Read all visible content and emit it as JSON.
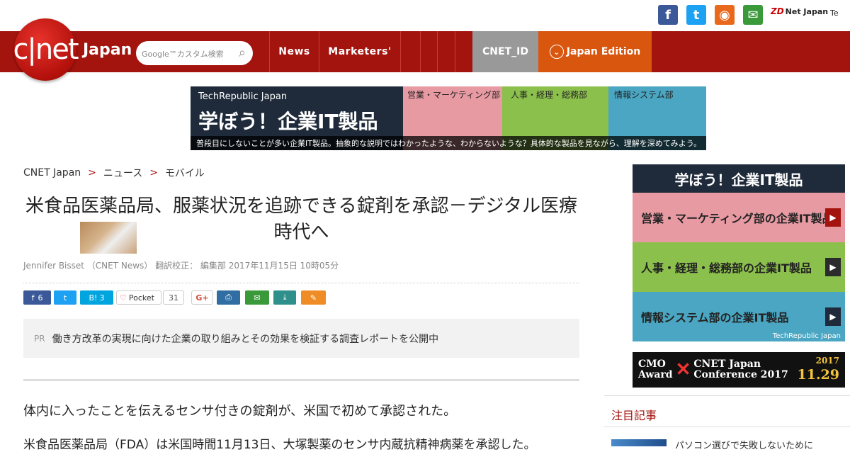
{
  "header": {
    "social": [
      {
        "name": "facebook-icon",
        "glyph": "f",
        "color": "#3b5998"
      },
      {
        "name": "twitter-icon",
        "glyph": "t",
        "color": "#1da1f2"
      },
      {
        "name": "rss-icon",
        "glyph": "◉",
        "color": "#e8691c"
      },
      {
        "name": "mail-icon",
        "glyph": "✉",
        "color": "#3a9a3a"
      }
    ],
    "zdnet_label": "Net Japan",
    "zdnet_mark": "ZD",
    "tech_label": "Te"
  },
  "nav": {
    "logo": "c|net",
    "brand": "Japan",
    "search_placeholder": "Google™カスタム検索",
    "items": [
      "News",
      "Marketers'"
    ],
    "cnet_id": "CNET_ID",
    "edition": "Japan Edition"
  },
  "banner": {
    "publisher": "TechRepublic Japan",
    "headline": "学ぼう！企業IT製品",
    "categories": [
      "営業・マーケティング部",
      "人事・経理・総務部",
      "情報システム部"
    ],
    "tagline": "普段目にしないことが多い企業IT製品。抽象的な説明ではわかったような、わからないような？具体的な製品を見ながら、理解を深めてみよう。"
  },
  "article": {
    "breadcrumb": [
      "CNET Japan",
      "ニュース",
      "モバイル"
    ],
    "headline": "米食品医薬品局、服薬状況を追跡できる錠剤を承認－デジタル医療時代へ",
    "byline": "Jennifer Bisset （CNET News） 翻訳校正： 編集部 2017年11月15日 10時05分",
    "share": {
      "facebook_count": "6",
      "hatena": "B!",
      "hatena_count": "3",
      "pocket": "Pocket",
      "pocket_count": "31",
      "gplus": "G+"
    },
    "pr_label": "PR",
    "pr_text": "働き方改革の実現に向けた企業の取り組みとその効果を検証する調査レポートを公開中",
    "lead": "体内に入ったことを伝えるセンサ付きの錠剤が、米国で初めて承認された。",
    "body1": "米食品医薬品局（FDA）は米国時間11月13日、大塚製薬のセンサ内蔵抗精神病薬を承認した。"
  },
  "sidebar": {
    "ad_title": "学ぼう！企業IT製品",
    "ad_rows": [
      {
        "label": "営業・マーケティング部の企業IT製品",
        "color": "#e89aa3"
      },
      {
        "label": "人事・経理・総務部の企業IT製品",
        "color": "#8cc04d"
      },
      {
        "label": "情報システム部の企業IT製品",
        "color": "#4aa6c2"
      }
    ],
    "ad_footer": "TechRepublic Japan",
    "cmo_line1": "CMO",
    "cmo_line2": "Award",
    "cmo_line3": "CNET Japan",
    "cmo_line4": "Conference 2017",
    "cmo_year": "2017",
    "cmo_date": "11.29",
    "section_title": "注目記事",
    "item_title": "パソコン選びで失敗しないために"
  }
}
